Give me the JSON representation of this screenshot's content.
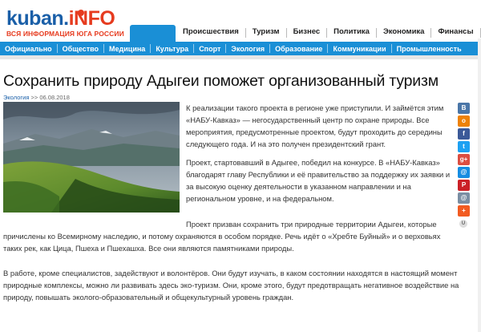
{
  "logo": {
    "main": "kuban.",
    "accent": "iNFO",
    "tagline": "ВСЯ ИНФОРМАЦИЯ ЮГА РОССИИ"
  },
  "top_nav": [
    "Происшествия",
    "Туризм",
    "Бизнес",
    "Политика",
    "Экономика",
    "Финансы",
    "Ка"
  ],
  "main_nav": [
    "Официально",
    "Общество",
    "Медицина",
    "Культура",
    "Спорт",
    "Экология",
    "Образование",
    "Коммуникации",
    "Промышленность"
  ],
  "article": {
    "title": "Сохранить природу Адыгеи поможет организованный туризм",
    "category": "Экология",
    "date_sep": ">>",
    "date": "06.08.2018",
    "paragraphs": [
      [
        "К реализации такого проекта в регионе уже приступили. И займётся этим",
        "«НАБУ-Кавказ» — негосударственный центр по охране природы. Все",
        "мероприятия, предусмотренные проектом, будут проходить до середины",
        "следующего года. И на это получен президентский грант."
      ],
      [
        "Проект, стартовавший в Адыгее, победил на конкурсе. В «НАБУ-Кавказ»",
        "благодарят главу Республики и её правительство за поддержку их заявки и",
        "за высокую оценку деятельности в указанном направлении и на",
        "региональном уровне, и на федеральном."
      ],
      [
        "Проект призван сохранить три природные территории Адыгеи, которые",
        "причислены ко Всемирному наследию, и потому охраняются в особом порядке. Речь идёт о «Хребте Буйный» и о верховьях",
        "таких рек, как Цица, Пшеха и Пшехашха. Все они являются памятниками природы."
      ],
      [
        "В работе, кроме специалистов, задействуют и волонтёров. Они будут изучать, в каком состоянии находятся в настоящий момент",
        "природные комплексы, можно ли развивать здесь эко-туризм. Они, кроме этого, будут предотвращать негативное воздействие на",
        "природу, повышать эколого-образовательный и общекультурный уровень граждан."
      ]
    ]
  },
  "share": [
    {
      "name": "vk-icon",
      "glyph": "В",
      "color": "#4a76a8"
    },
    {
      "name": "odnoklassniki-icon",
      "glyph": "о",
      "color": "#ee8208"
    },
    {
      "name": "facebook-icon",
      "glyph": "f",
      "color": "#3b5998"
    },
    {
      "name": "twitter-icon",
      "glyph": "t",
      "color": "#1da1f2"
    },
    {
      "name": "google-plus-icon",
      "glyph": "g+",
      "color": "#dc4e41"
    },
    {
      "name": "moimir-icon",
      "glyph": "@",
      "color": "#168de2"
    },
    {
      "name": "pinterest-icon",
      "glyph": "P",
      "color": "#cb2027"
    },
    {
      "name": "email-icon",
      "glyph": "@",
      "color": "#7a8ea3"
    },
    {
      "name": "more-icon",
      "glyph": "+",
      "color": "#f25b21"
    },
    {
      "name": "counter-icon",
      "glyph": "U",
      "color": "#dddddd"
    }
  ]
}
